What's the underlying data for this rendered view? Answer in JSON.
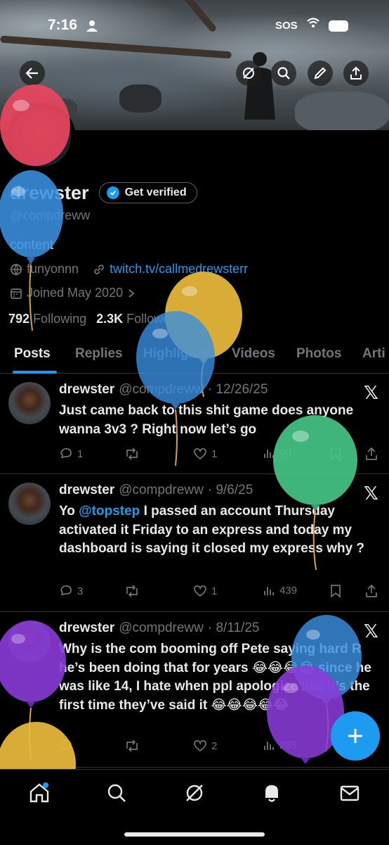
{
  "status_bar": {
    "time": "7:16",
    "sos": "SOS"
  },
  "profile": {
    "name": "drewster",
    "get_verified": "Get verified",
    "handle": "@compdreww",
    "bio": "content",
    "location": "funyonnn",
    "link": "twitch.tv/callmedrewsterr",
    "joined": "Joined May 2020",
    "following_count": "792",
    "following_label": "Following",
    "followers_count": "2.3K",
    "followers_label": "Followers"
  },
  "tabs": [
    "Posts",
    "Replies",
    "Highlights",
    "Videos",
    "Photos",
    "Arti"
  ],
  "posts": [
    {
      "name": "drewster",
      "handle": "@compdreww",
      "date": "· 12/26/25",
      "text": "Just came back to this shit game does anyone wanna 3v3 ? Right now let’s go",
      "replies": "1",
      "reposts": "",
      "likes": "1",
      "views": "90"
    },
    {
      "name": "drewster",
      "handle": "@compdreww",
      "date": "· 9/6/25",
      "mention": "@topstep",
      "text_pre": "Yo ",
      "text_post": " I passed an account Thursday activated it Friday to an express and today my dashboard is saying it closed my express why ?",
      "replies": "3",
      "reposts": "",
      "likes": "1",
      "views": "439"
    },
    {
      "name": "drewster",
      "handle": "@compdreww",
      "date": "· 8/11/25",
      "text": "Why is the com booming off Pete saying hard R he’s been doing that for years 😂😂😂😂 since he was like 14, I hate when ppl apologize like it’s the first time they’ve said it 😂😂😂😂😂",
      "replies": "",
      "reposts": "",
      "likes": "2",
      "views": "235"
    }
  ],
  "icons": {
    "back": "back-arrow-icon",
    "grok": "grok-icon",
    "search": "search-icon",
    "edit": "edit-icon",
    "share": "share-icon"
  },
  "colors": {
    "accent": "#1d9bf0",
    "text": "#e7e9ea",
    "muted": "#71767b",
    "background": "#000000"
  }
}
